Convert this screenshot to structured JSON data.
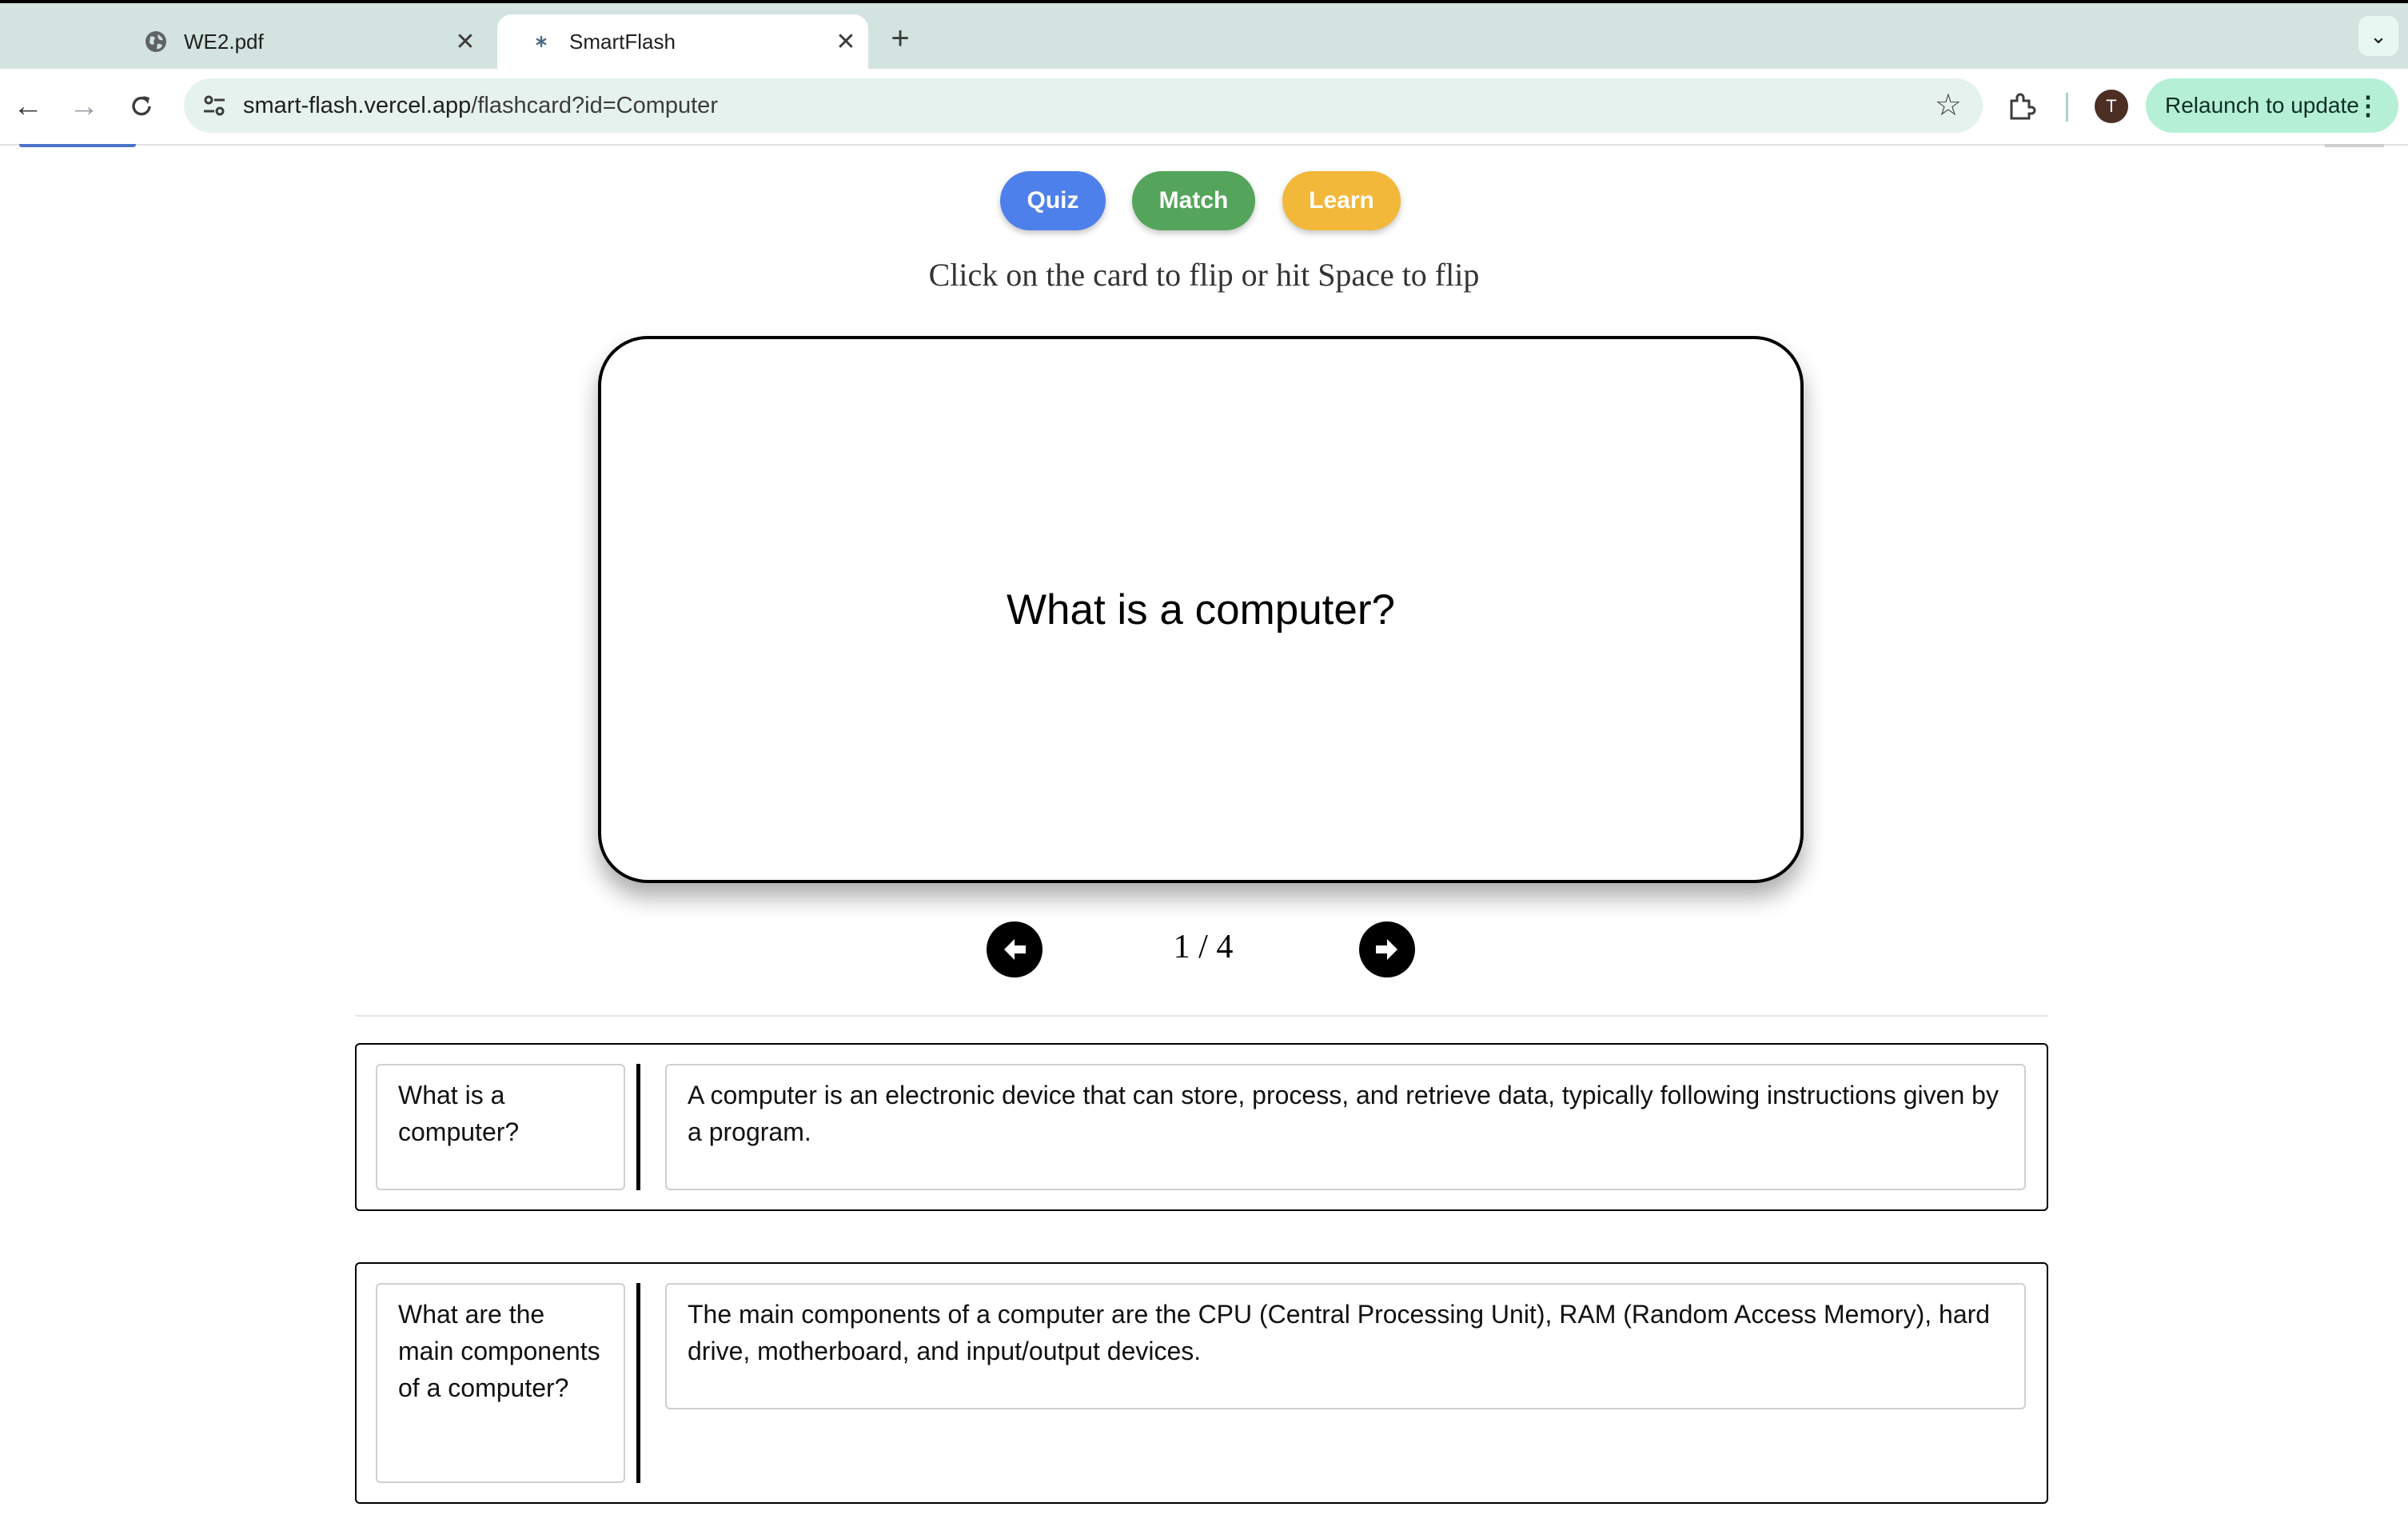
{
  "browser": {
    "tabs": [
      {
        "title": "WE2.pdf",
        "icon": "globe-icon",
        "active": false
      },
      {
        "title": "SmartFlash",
        "icon": "asterisk-favicon",
        "active": true
      }
    ],
    "url_host": "smart-flash.vercel.app",
    "url_path": "/flashcard?id=Computer",
    "profile_initial": "T",
    "relaunch_label": "Relaunch to update"
  },
  "app": {
    "modes": {
      "quiz": "Quiz",
      "match": "Match",
      "learn": "Learn"
    },
    "mode_colors": {
      "quiz": "#4d80ea",
      "match": "#54a55b",
      "learn": "#f2b83a"
    },
    "hint": "Click on the card to flip or hit Space to flip",
    "card_text": "What is a computer?",
    "counter": "1 / 4",
    "pairs": [
      {
        "term": "What is a computer?",
        "definition": "A computer is an electronic device that can store, process, and retrieve data, typically following instructions given by a program."
      },
      {
        "term": "What are the main components of a computer?",
        "definition": "The main components of a computer are the CPU (Central Processing Unit), RAM (Random Access Memory), hard drive, motherboard, and input/output devices."
      }
    ]
  }
}
